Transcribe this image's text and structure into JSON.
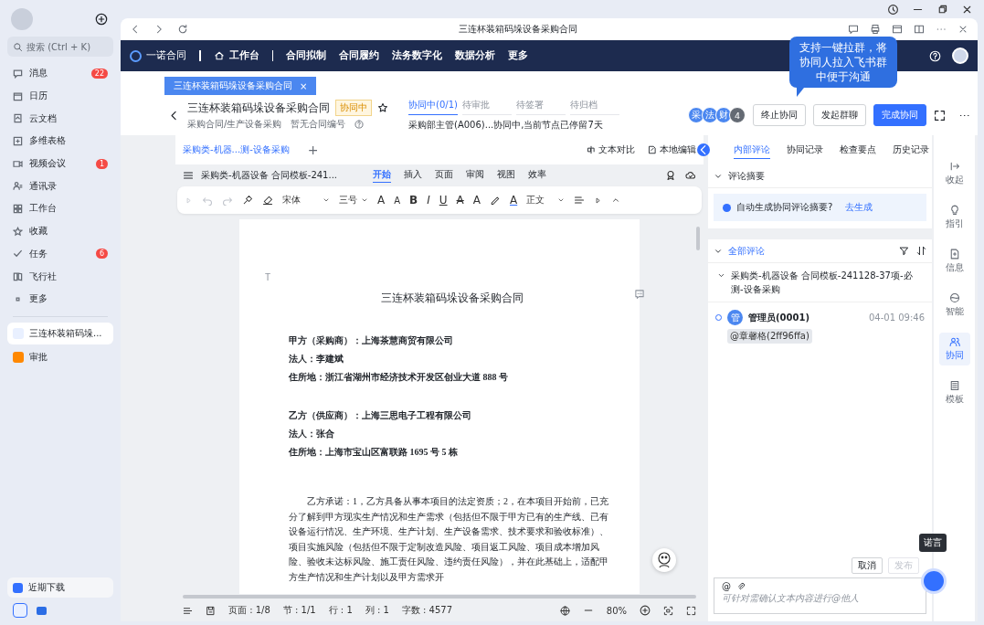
{
  "sidebar": {
    "search_placeholder": "搜索 (Ctrl + K)",
    "items": [
      {
        "label": "消息",
        "badge": "22"
      },
      {
        "label": "日历"
      },
      {
        "label": "云文档"
      },
      {
        "label": "多维表格"
      },
      {
        "label": "视频会议",
        "badge": "1"
      },
      {
        "label": "通讯录"
      },
      {
        "label": "工作台"
      },
      {
        "label": "收藏"
      },
      {
        "label": "任务",
        "badge": "6"
      },
      {
        "label": "飞行社"
      },
      {
        "label": "更多"
      }
    ],
    "recent": [
      {
        "label": "三连杯装箱码垛...",
        "selected": true
      },
      {
        "label": "审批",
        "selected": false
      }
    ],
    "downloads": "近期下载"
  },
  "browser": {
    "title": "三连杯装箱码垛设备采购合同"
  },
  "navbar": {
    "brand": "一诺合同",
    "home": "工作台",
    "items": [
      "合同拟制",
      "合同履约",
      "法务数字化",
      "数据分析",
      "更多"
    ]
  },
  "open_tabs": [
    {
      "label": "三连杯装箱码垛设备采购合同",
      "close": "×"
    }
  ],
  "header": {
    "title": "三连杯装箱码垛设备采购合同",
    "status_badge": "协同中",
    "path": "采购合同/生产设备采购",
    "number": "暂无合同编号",
    "steps": [
      {
        "label": "协同中(0/1)",
        "selected": true
      },
      {
        "label": "待审批",
        "selected": false
      },
      {
        "label": "待签署",
        "selected": false
      },
      {
        "label": "待归档",
        "selected": false
      }
    ],
    "progress_note": "采购部主管(A006)...协同中,当前节点已停留7天",
    "participants": [
      "采",
      "法",
      "财"
    ],
    "participant_count": "4",
    "buttons": [
      {
        "label": "终止协同",
        "kind": "default"
      },
      {
        "label": "发起群聊",
        "kind": "default"
      },
      {
        "label": "完成协同",
        "kind": "primary"
      }
    ]
  },
  "tooltip": "支持一键拉群，将协同人拉入飞书群中便于沟通",
  "document": {
    "tabs": [
      {
        "label": "采购类-机器...测-设备采购",
        "selected": true
      }
    ],
    "add": "+",
    "actions": [
      "文本对比",
      "本地编辑"
    ],
    "filename": "采购类-机器设备 合同模板-241...",
    "menu": [
      {
        "label": "开始",
        "selected": true
      },
      {
        "label": "插入",
        "selected": false
      },
      {
        "label": "页面",
        "selected": false
      },
      {
        "label": "审阅",
        "selected": false
      },
      {
        "label": "视图",
        "selected": false
      },
      {
        "label": "效率",
        "selected": false
      }
    ],
    "toolbar": {
      "font": "宋体",
      "size": "三号",
      "letters": [
        {
          "label": "A",
          "kind": "grow"
        },
        {
          "label": "A",
          "kind": "shrink"
        },
        {
          "label": "B",
          "kind": "bold"
        },
        {
          "label": "I",
          "kind": "italic"
        },
        {
          "label": "U",
          "kind": "underline"
        },
        {
          "label": "A",
          "kind": "strike"
        },
        {
          "label": "A",
          "kind": "effect"
        },
        {
          "label": "A",
          "kind": "color"
        }
      ],
      "style": "正文"
    },
    "page": {
      "marker": "T",
      "title": "三连杯装箱码垛设备采购合同",
      "parties": [
        [
          "甲方（采购商）：上海茶慧商贸有限公司",
          "法人：李建斌",
          "住所地：浙江省湖州市经济技术开发区创业大道 888 号"
        ],
        [
          "乙方（供应商）：上海三思电子工程有限公司",
          "法人：张合",
          "住所地：上海市宝山区富联路 1695 号 5 栋"
        ]
      ],
      "paragraph": "乙方承诺：1，乙方具备从事本项目的法定资质；2，在本项目开始前，已充分了解到甲方现实生产情况和生产需求（包括但不限于甲方已有的生产线、已有设备运行情况、生产环境、生产计划、生产设备需求、技术要求和验收标准）、项目实施风险（包括但不限于定制改造风险、项目返工风险、项目成本增加风险、验收未达标风险、施工责任风险、违约责任风险），并在此基础上，适配甲方生产情况和生产计划以及甲方需求开"
    },
    "status": {
      "page": "页面 : 1/8",
      "section": "节 : 1/1",
      "row": "行 : 1",
      "column": "列 : 1",
      "words": "字数 : 4577",
      "zoom": "80%"
    }
  },
  "comments": {
    "tabs": [
      {
        "label": "内部评论",
        "selected": true
      },
      {
        "label": "协同记录",
        "selected": false
      },
      {
        "label": "检查要点",
        "selected": false
      },
      {
        "label": "历史记录",
        "selected": false
      }
    ],
    "summary": {
      "title": "评论摘要",
      "prompt": "自动生成协同评论摘要?",
      "action": "去生成"
    },
    "all": {
      "title": "全部评论",
      "thread": "采购类-机器设备 合同模板-241128-37项-必测-设备采购",
      "items": [
        {
          "avatar": "管",
          "author": "管理员(0001)",
          "time": "04-01 09:46",
          "mention": "@章馨格(2ff96ffa)"
        }
      ]
    },
    "cancel": {
      "label": "取消",
      "disabled": false
    },
    "publish": {
      "label": "发布",
      "disabled": true
    },
    "input_at": "@",
    "input_placeholder": "可针对需确认文本内容进行@他人"
  },
  "rail": [
    {
      "label": "收起",
      "selected": false
    },
    {
      "label": "指引",
      "selected": false
    },
    {
      "label": "信息",
      "selected": false
    },
    {
      "label": "智能",
      "selected": false
    },
    {
      "label": "协同",
      "selected": true
    },
    {
      "label": "模板",
      "selected": false
    }
  ],
  "assistant_tooltip": "诺言"
}
